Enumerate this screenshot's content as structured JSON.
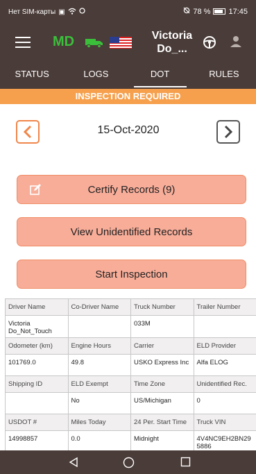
{
  "status_bar": {
    "carrier": "Нет SIM-карты",
    "battery": "78 %",
    "time": "17:45"
  },
  "app_bar": {
    "region": "MD",
    "driver": "Victoria Do_..."
  },
  "tabs": [
    {
      "label": "STATUS"
    },
    {
      "label": "LOGS"
    },
    {
      "label": "DOT"
    },
    {
      "label": "RULES"
    }
  ],
  "banner": "INSPECTION REQUIRED",
  "date_nav": {
    "date": "15-Oct-2020"
  },
  "buttons": {
    "certify": "Certify Records (9)",
    "view_unidentified": "View Unidentified Records",
    "start_inspection": "Start Inspection"
  },
  "info_table": [
    {
      "labels": [
        "Driver Name",
        "Co-Driver Name",
        "Truck Number",
        "Trailer Number"
      ],
      "values": [
        "Victoria Do_Not_Touch",
        "",
        "033M",
        ""
      ]
    },
    {
      "labels": [
        "Odometer (km)",
        "Engine Hours",
        "Carrier",
        "ELD Provider"
      ],
      "values": [
        "101769.0",
        "49.8",
        "USKO Express Inc",
        "Alfa ELOG"
      ]
    },
    {
      "labels": [
        "Shipping ID",
        "ELD Exempt",
        "Time Zone",
        "Unidentified Rec."
      ],
      "values": [
        "",
        "No",
        "US/Michigan",
        "0"
      ]
    },
    {
      "labels": [
        "USDOT #",
        "Miles Today",
        "24 Per. Start Time",
        "Truck VIN"
      ],
      "values": [
        "14998857",
        "0.0",
        "Midnight",
        "4V4NC9EH2BN295886"
      ]
    }
  ]
}
